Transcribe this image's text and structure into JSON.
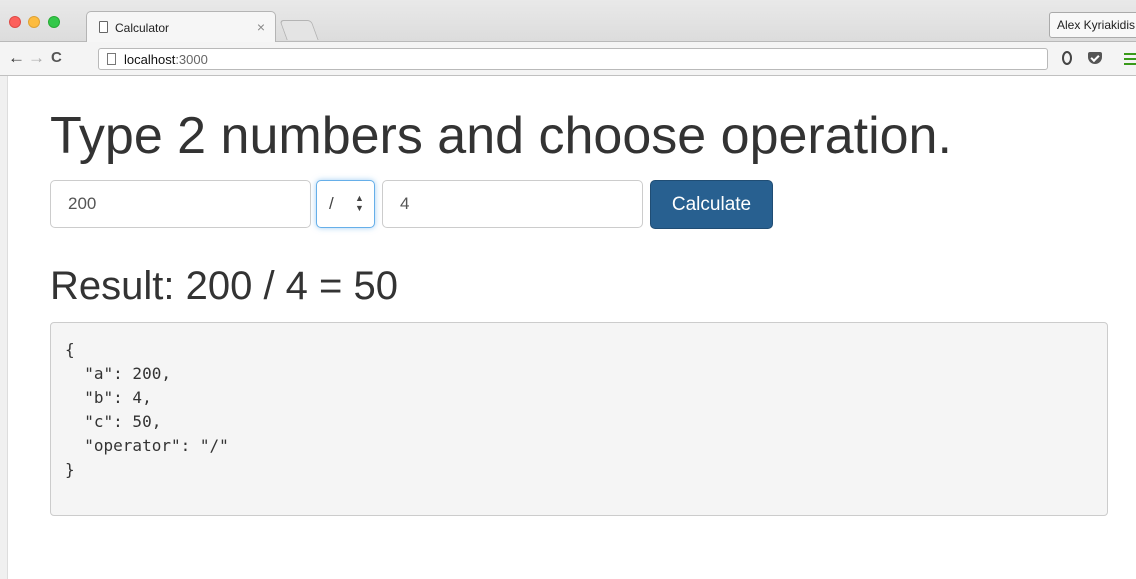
{
  "browser": {
    "tab_title": "Calculator",
    "tab_close": "×",
    "profile_name": "Alex Kyriakidis",
    "url_host": "localhost",
    "url_port": ":3000",
    "icons": [
      "back-arrow-icon",
      "forward-arrow-icon",
      "reload-icon",
      "page-icon",
      "opera-extension-icon",
      "pocket-extension-icon",
      "menu-icon"
    ]
  },
  "page": {
    "heading": "Type 2 numbers and choose operation.",
    "input_a": "200",
    "operator": "/",
    "input_b": "4",
    "calculate_label": "Calculate",
    "result_text": "Result: 200 / 4 = 50",
    "json_output": "{\n  \"a\": 200,\n  \"b\": 4,\n  \"c\": 50,\n  \"operator\": \"/\"\n}"
  },
  "colors": {
    "button_bg": "#286090",
    "focus_ring": "#66afe9",
    "text": "#333333"
  }
}
